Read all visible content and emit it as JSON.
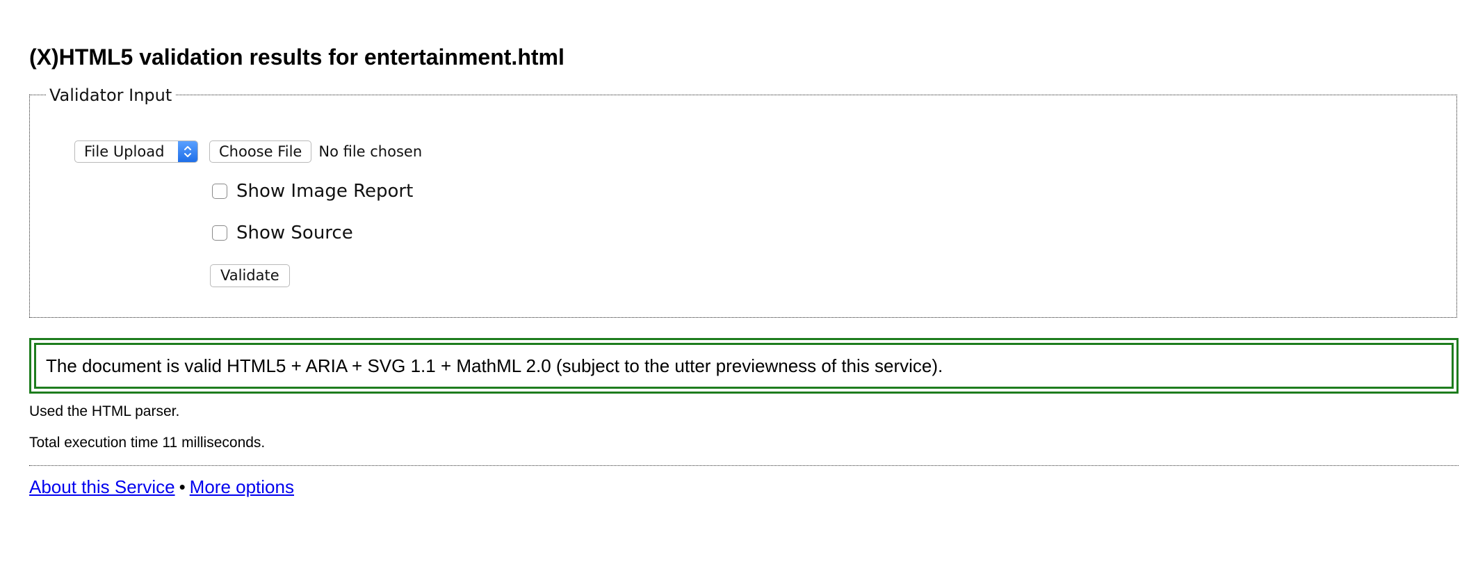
{
  "heading": "(X)HTML5 validation results for entertainment.html",
  "validator": {
    "legend": "Validator Input",
    "mode_select": {
      "selected": "File Upload"
    },
    "file_button_label": "Choose File",
    "file_status": "No file chosen",
    "options": [
      {
        "label": "Show Image Report",
        "checked": false
      },
      {
        "label": "Show Source",
        "checked": false
      }
    ],
    "validate_label": "Validate"
  },
  "result": {
    "message": "The document is valid HTML5 + ARIA + SVG 1.1 + MathML 2.0 (subject to the utter previewness of this service).",
    "color": "#1e7d1e"
  },
  "details": {
    "parser": "Used the HTML parser.",
    "timing": "Total execution time 11 milliseconds."
  },
  "footer": {
    "about_link": "About this Service",
    "separator": "•",
    "options_link": "More options"
  },
  "colors": {
    "link": "#0000ee",
    "select_accent": "#1f6fe8"
  }
}
